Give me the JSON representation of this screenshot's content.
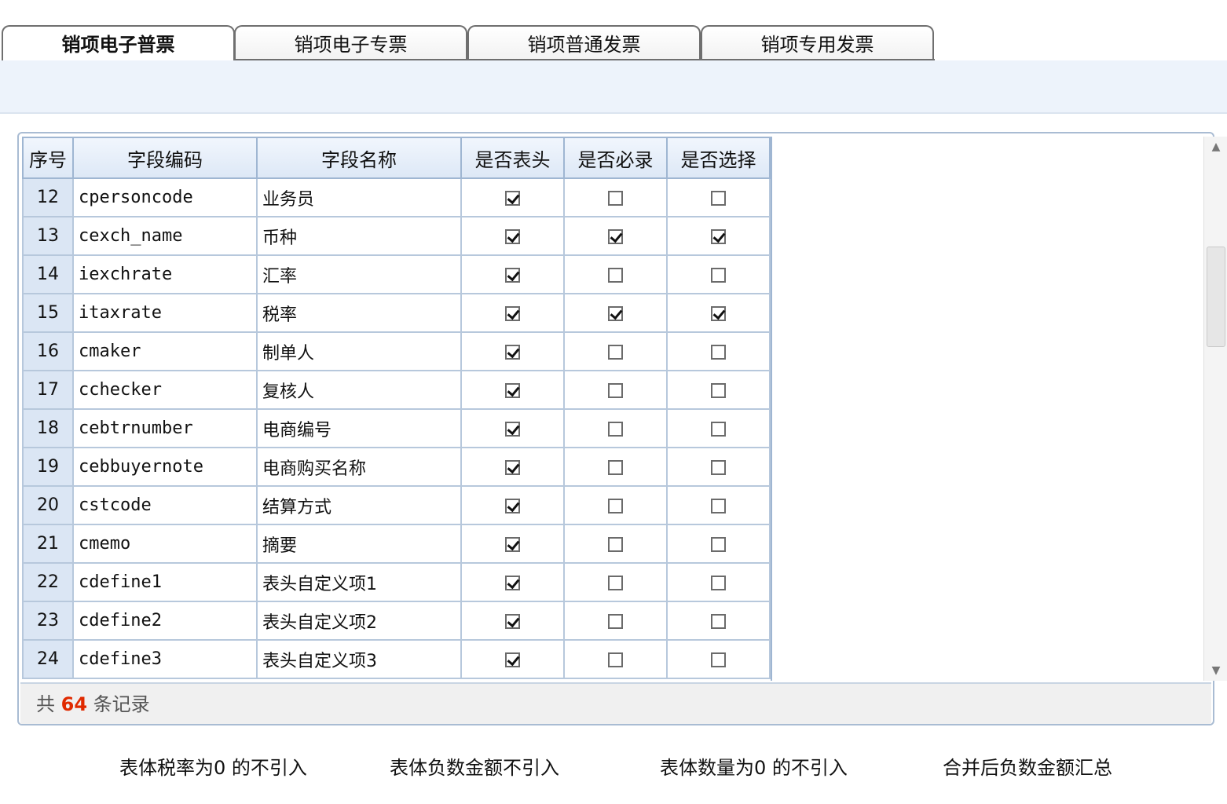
{
  "tabs": [
    {
      "label": "销项电子普票",
      "active": true
    },
    {
      "label": "销项电子专票",
      "active": false
    },
    {
      "label": "销项普通发票",
      "active": false
    },
    {
      "label": "销项专用发票",
      "active": false
    }
  ],
  "grid": {
    "headers": [
      "序号",
      "字段编码",
      "字段名称",
      "是否表头",
      "是否必录",
      "是否选择"
    ],
    "rows": [
      {
        "seq": "12",
        "code": "cpersoncode",
        "name": "业务员",
        "header": true,
        "required": false,
        "select": false
      },
      {
        "seq": "13",
        "code": "cexch_name",
        "name": "币种",
        "header": true,
        "required": true,
        "select": true
      },
      {
        "seq": "14",
        "code": "iexchrate",
        "name": "汇率",
        "header": true,
        "required": false,
        "select": false
      },
      {
        "seq": "15",
        "code": "itaxrate",
        "name": "税率",
        "header": true,
        "required": true,
        "select": true
      },
      {
        "seq": "16",
        "code": "cmaker",
        "name": "制单人",
        "header": true,
        "required": false,
        "select": false
      },
      {
        "seq": "17",
        "code": "cchecker",
        "name": "复核人",
        "header": true,
        "required": false,
        "select": false
      },
      {
        "seq": "18",
        "code": "cebtrnumber",
        "name": "电商编号",
        "header": true,
        "required": false,
        "select": false
      },
      {
        "seq": "19",
        "code": "cebbuyernote",
        "name": "电商购买名称",
        "header": true,
        "required": false,
        "select": false
      },
      {
        "seq": "20",
        "code": "cstcode",
        "name": "结算方式",
        "header": true,
        "required": false,
        "select": false
      },
      {
        "seq": "21",
        "code": "cmemo",
        "name": "摘要",
        "header": true,
        "required": false,
        "select": false
      },
      {
        "seq": "22",
        "code": "cdefine1",
        "name": "表头自定义项1",
        "header": true,
        "required": false,
        "select": false
      },
      {
        "seq": "23",
        "code": "cdefine2",
        "name": "表头自定义项2",
        "header": true,
        "required": false,
        "select": false
      },
      {
        "seq": "24",
        "code": "cdefine3",
        "name": "表头自定义项3",
        "header": true,
        "required": false,
        "select": false
      }
    ]
  },
  "footer": {
    "prefix": "共",
    "count": "64",
    "suffix": "条记录"
  },
  "options": [
    "表体税率为0 的不引入",
    "表体负数金额不引入",
    "表体数量为0 的不引入",
    "合并后负数金额汇总"
  ],
  "colors": {
    "accent_count": "#e02a00",
    "header_bg": "#dde8f6",
    "band_bg": "#edf3fb"
  }
}
